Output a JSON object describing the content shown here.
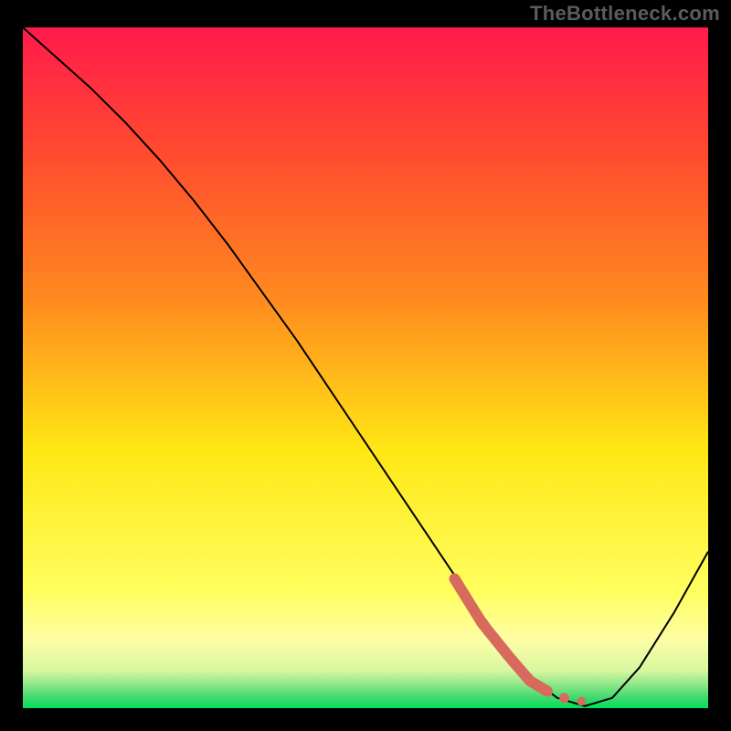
{
  "attribution": "TheBottleneck.com",
  "chart_data": {
    "type": "line",
    "title": "",
    "xlabel": "",
    "ylabel": "",
    "xlim": [
      0,
      100
    ],
    "ylim": [
      0,
      100
    ],
    "grid": false,
    "legend": false,
    "axes_visible": false,
    "background_gradient": {
      "top": "#ff1a4c",
      "mid_upper": "#ff8a1f",
      "mid": "#ffe715",
      "mid_lower": "#fdfea5",
      "bottom": "#00e05a"
    },
    "series": [
      {
        "name": "bottleneck-curve",
        "color": "#000000",
        "stroke_width": 2,
        "x": [
          0,
          5,
          10,
          15,
          20,
          25,
          30,
          35,
          40,
          45,
          50,
          55,
          60,
          65,
          70,
          74,
          78,
          82,
          86,
          90,
          95,
          100
        ],
        "y": [
          100,
          95.5,
          91,
          86,
          80.5,
          74.5,
          68,
          61,
          54,
          46.5,
          39,
          31.5,
          24,
          16.5,
          9.5,
          4.5,
          1.5,
          0.3,
          1.5,
          6,
          14,
          23
        ]
      },
      {
        "name": "sweet-spot-marker",
        "color": "#d86a5d",
        "style": "thick-with-dots",
        "stroke_width": 12,
        "x": [
          63,
          67,
          71,
          74,
          76.5,
          79,
          81.5
        ],
        "y": [
          19,
          12.5,
          7.5,
          4,
          2.5,
          1.5,
          1
        ]
      }
    ]
  }
}
